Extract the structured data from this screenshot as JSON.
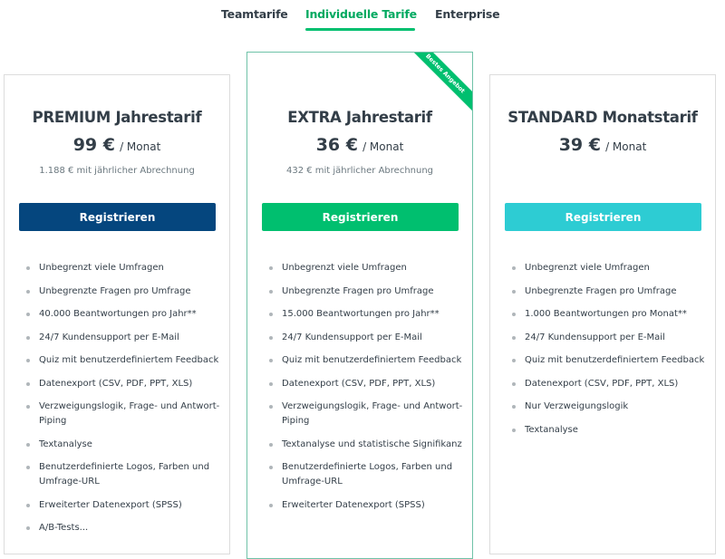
{
  "tabs": [
    {
      "label": "Teamtarife",
      "active": false
    },
    {
      "label": "Individuelle Tarife",
      "active": true
    },
    {
      "label": "Enterprise",
      "active": false
    }
  ],
  "colors": {
    "accent_green": "#00bf6f",
    "premium_button": "#05467e",
    "extra_button": "#00bf6f",
    "standard_button": "#2dccd3",
    "highlight_border": "#6fc2a8"
  },
  "plans": [
    {
      "title": "PREMIUM Jahrestarif",
      "price": "99 €",
      "period": "/ Monat",
      "billing": "1.188 € mit jährlicher Abrechnung",
      "button_label": "Registrieren",
      "features": [
        "Unbegrenzt viele Umfragen",
        "Unbegrenzte Fragen pro Umfrage",
        "40.000 Beantwortungen pro Jahr**",
        "24/7 Kundensupport per E-Mail",
        "Quiz mit benutzerdefiniertem Feedback",
        "Datenexport (CSV, PDF, PPT, XLS)",
        "Verzweigungslogik, Frage- und Antwort-Piping",
        "Textanalyse",
        "Benutzerdefinierte Logos, Farben und Umfrage-URL",
        "Erweiterter Datenexport (SPSS)",
        "A/B-Tests..."
      ]
    },
    {
      "title": "EXTRA Jahrestarif",
      "ribbon": "Bestes Angebot",
      "price": "36 €",
      "period": "/ Monat",
      "billing": "432 € mit jährlicher Abrechnung",
      "button_label": "Registrieren",
      "features": [
        "Unbegrenzt viele Umfragen",
        "Unbegrenzte Fragen pro Umfrage",
        "15.000 Beantwortungen pro Jahr**",
        "24/7 Kundensupport per E-Mail",
        "Quiz mit benutzerdefiniertem Feedback",
        "Datenexport (CSV, PDF, PPT, XLS)",
        "Verzweigungslogik, Frage- und Antwort-Piping",
        "Textanalyse und statistische Signifikanz",
        "Benutzerdefinierte Logos, Farben und Umfrage-URL",
        "Erweiterter Datenexport (SPSS)"
      ]
    },
    {
      "title": "STANDARD Monatstarif",
      "price": "39 €",
      "period": "/ Monat",
      "button_label": "Registrieren",
      "features": [
        "Unbegrenzt viele Umfragen",
        "Unbegrenzte Fragen pro Umfrage",
        "1.000 Beantwortungen pro Monat**",
        "24/7 Kundensupport per E-Mail",
        "Quiz mit benutzerdefiniertem Feedback",
        "Datenexport (CSV, PDF, PPT, XLS)",
        "Nur Verzweigungslogik",
        "Textanalyse"
      ]
    }
  ]
}
